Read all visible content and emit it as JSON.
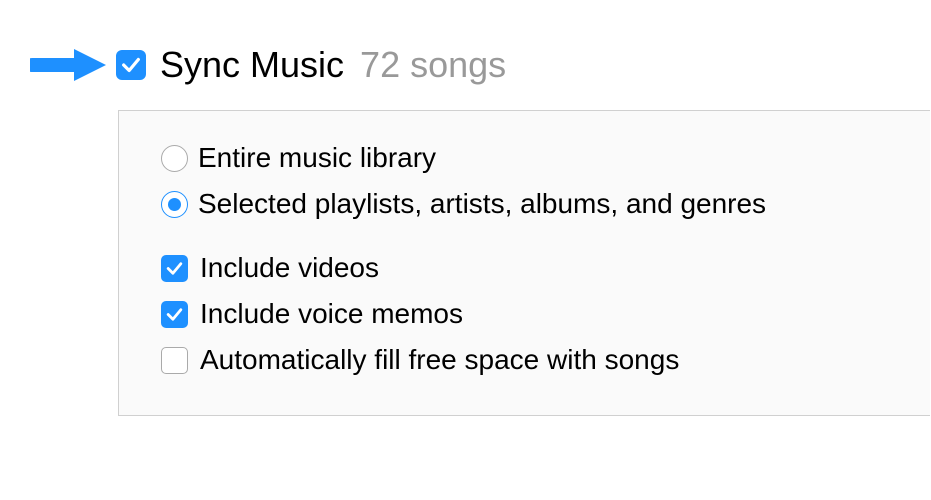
{
  "header": {
    "title": "Sync Music",
    "count": "72 songs",
    "checked": true
  },
  "radios": {
    "entire": {
      "label": "Entire music library",
      "selected": false
    },
    "selected": {
      "label": "Selected playlists, artists, albums, and genres",
      "selected": true
    }
  },
  "checkboxes": {
    "videos": {
      "label": "Include videos",
      "checked": true
    },
    "voicememos": {
      "label": "Include voice memos",
      "checked": true
    },
    "autofill": {
      "label": "Automatically fill free space with songs",
      "checked": false
    }
  }
}
